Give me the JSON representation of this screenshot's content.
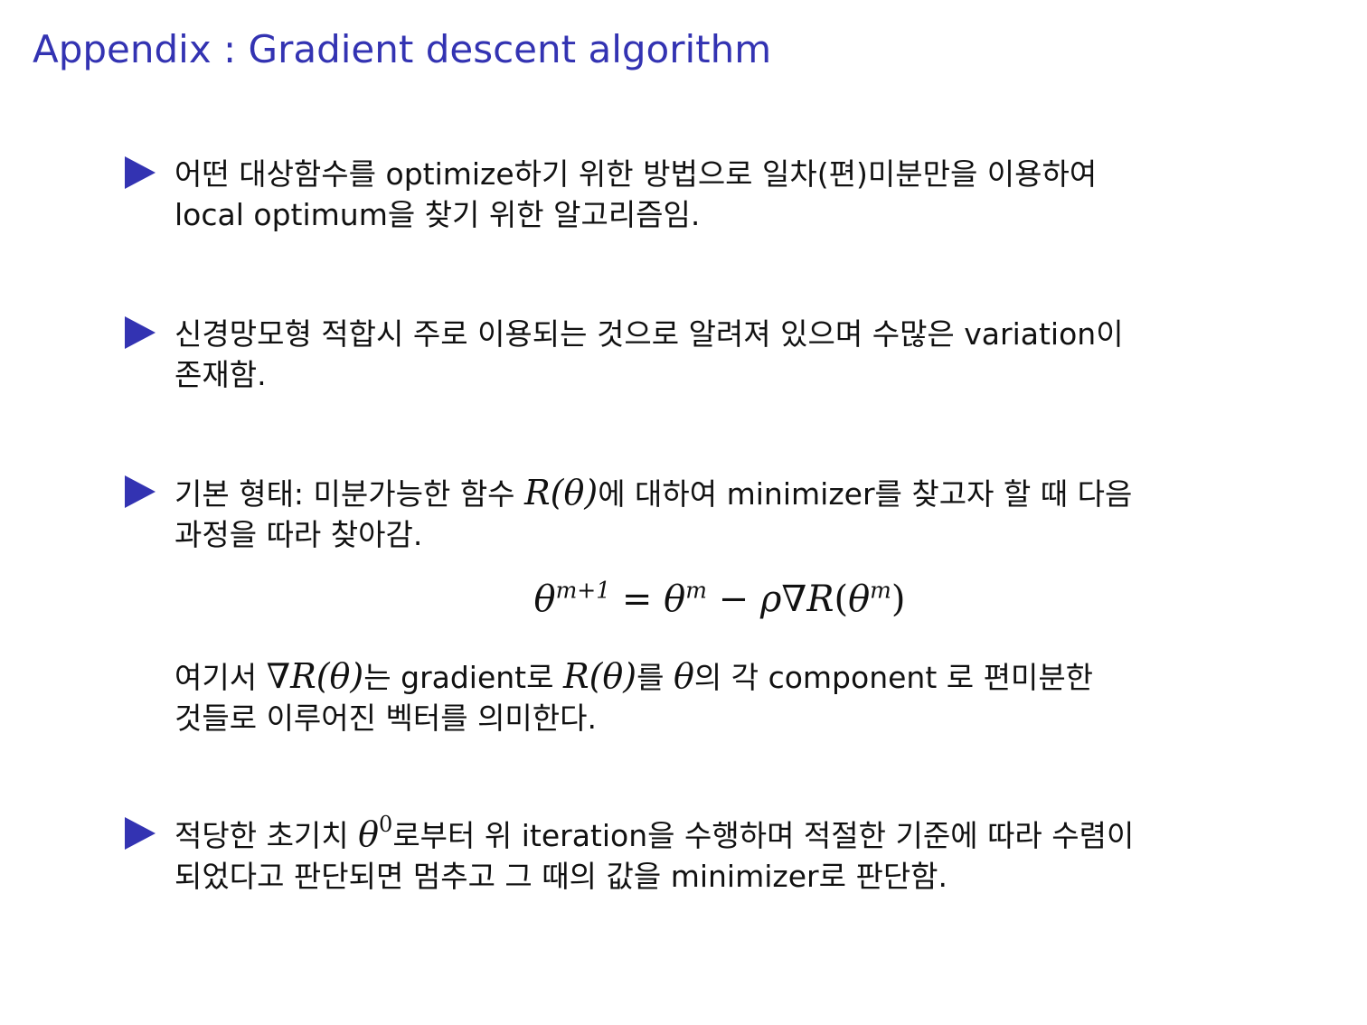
{
  "title": "Appendix : Gradient descent algorithm",
  "bullets": [
    {
      "line1": "어떤 대상함수를 optimize하기 위한 방법으로 일차(편)미분만을 이용하여",
      "line2": "local optimum을 찾기 위한 알고리즘임."
    },
    {
      "line1": "신경망모형 적합시 주로 이용되는 것으로 알려져 있으며 수많은 variation이",
      "line2": "존재함."
    },
    {
      "line1_a": "기본 형태: 미분가능한 함수 ",
      "line1_math": "R(θ)",
      "line1_b": "에 대하여 minimizer를 찾고자 할 때 다음",
      "line2": "과정을 따라 찾아감."
    },
    {
      "line1_a": "적당한 초기치 ",
      "line1_math_base": "θ",
      "line1_math_sup": "0",
      "line1_b": "로부터 위 iteration을 수행하며 적절한 기준에 따라 수렴이",
      "line2": "되었다고 판단되면 멈추고 그 때의 값을 minimizer로 판단함."
    }
  ],
  "equation": {
    "lhs_base": "θ",
    "lhs_sup": "m+1",
    "eq": " = ",
    "rhs1_base": "θ",
    "rhs1_sup": "m",
    "minus": " − ",
    "rho": "ρ",
    "nabla": "∇",
    "R": "R",
    "open": "(",
    "rhs2_base": "θ",
    "rhs2_sup": "m",
    "close": ")"
  },
  "explanation": {
    "t1": "여기서 ",
    "m1": "∇R(θ)",
    "t2": "는 gradient로 ",
    "m2": "R(θ)",
    "t3": "를 ",
    "m3": "θ",
    "t4": "의 각 component 로 편미분한",
    "line2": "것들로 이루어진 벡터를 의미한다."
  },
  "colors": {
    "accent": "#3333b2",
    "text": "#111111"
  },
  "icons": {
    "bullet_marker": "triangle-right-icon"
  }
}
